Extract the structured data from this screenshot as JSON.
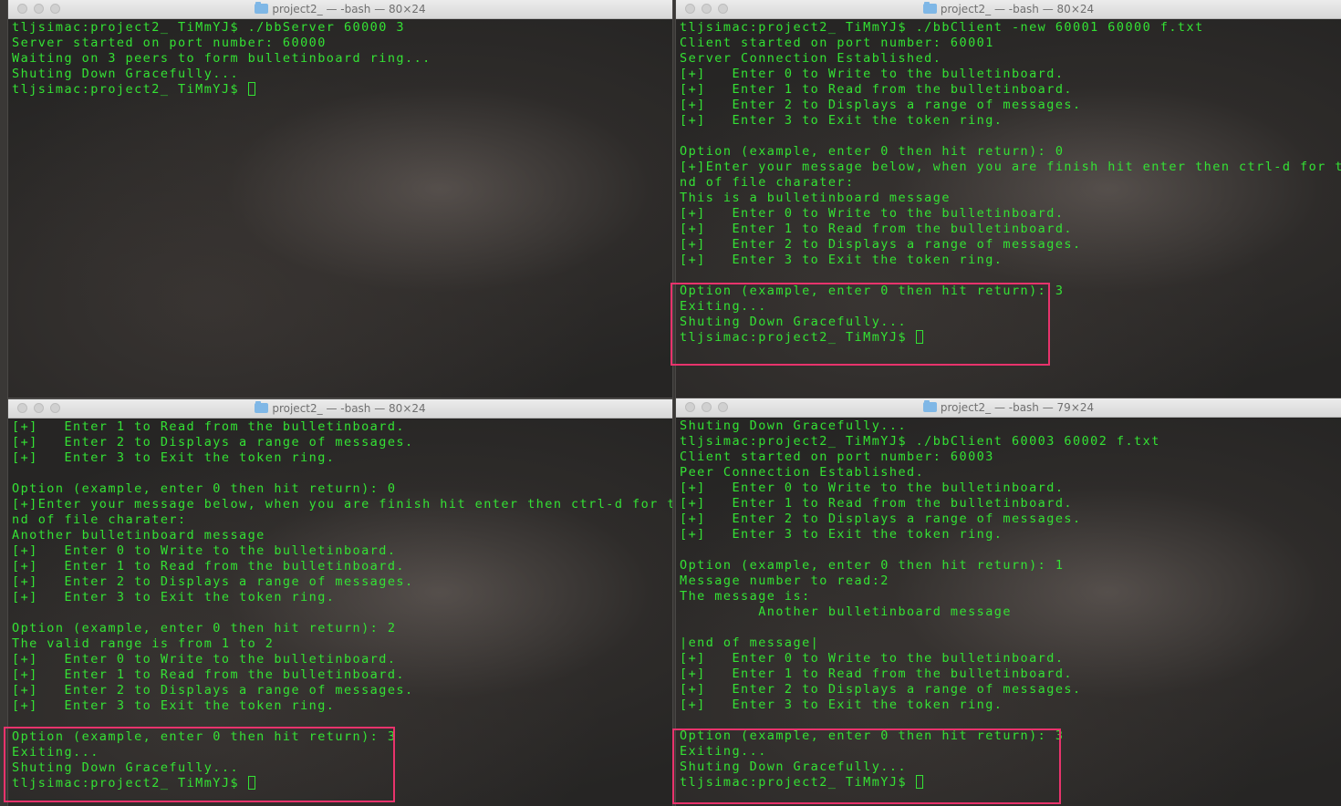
{
  "windows": [
    {
      "title": "project2_ — -bash — 80×24",
      "lines": [
        "tljsimac:project2_ TiMmYJ$ ./bbServer 60000 3",
        "Server started on port number: 60000",
        "Waiting on 3 peers to form bulletinboard ring...",
        "Shuting Down Gracefully...",
        "tljsimac:project2_ TiMmYJ$ "
      ]
    },
    {
      "title": "project2_ — -bash — 80×24",
      "lines": [
        "tljsimac:project2_ TiMmYJ$ ./bbClient -new 60001 60000 f.txt",
        "Client started on port number: 60001",
        "Server Connection Established.",
        "[+]   Enter 0 to Write to the bulletinboard.",
        "[+]   Enter 1 to Read from the bulletinboard.",
        "[+]   Enter 2 to Displays a range of messages.",
        "[+]   Enter 3 to Exit the token ring.",
        "",
        "Option (example, enter 0 then hit return): 0",
        "[+]Enter your message below, when you are finish hit enter then ctrl-d for the e",
        "nd of file charater:",
        "This is a bulletinboard message",
        "[+]   Enter 0 to Write to the bulletinboard.",
        "[+]   Enter 1 to Read from the bulletinboard.",
        "[+]   Enter 2 to Displays a range of messages.",
        "[+]   Enter 3 to Exit the token ring.",
        "",
        "Option (example, enter 0 then hit return): 3",
        "Exiting...",
        "Shuting Down Gracefully...",
        "tljsimac:project2_ TiMmYJ$ "
      ]
    },
    {
      "title": "project2_ — -bash — 80×24",
      "lines": [
        "[+]   Enter 1 to Read from the bulletinboard.",
        "[+]   Enter 2 to Displays a range of messages.",
        "[+]   Enter 3 to Exit the token ring.",
        "",
        "Option (example, enter 0 then hit return): 0",
        "[+]Enter your message below, when you are finish hit enter then ctrl-d for the e",
        "nd of file charater:",
        "Another bulletinboard message",
        "[+]   Enter 0 to Write to the bulletinboard.",
        "[+]   Enter 1 to Read from the bulletinboard.",
        "[+]   Enter 2 to Displays a range of messages.",
        "[+]   Enter 3 to Exit the token ring.",
        "",
        "Option (example, enter 0 then hit return): 2",
        "The valid range is from 1 to 2",
        "[+]   Enter 0 to Write to the bulletinboard.",
        "[+]   Enter 1 to Read from the bulletinboard.",
        "[+]   Enter 2 to Displays a range of messages.",
        "[+]   Enter 3 to Exit the token ring.",
        "",
        "Option (example, enter 0 then hit return): 3",
        "Exiting...",
        "Shuting Down Gracefully...",
        "tljsimac:project2_ TiMmYJ$ "
      ]
    },
    {
      "title": "project2_ — -bash — 79×24",
      "lines": [
        "Shuting Down Gracefully...",
        "tljsimac:project2_ TiMmYJ$ ./bbClient 60003 60002 f.txt",
        "Client started on port number: 60003",
        "Peer Connection Established.",
        "[+]   Enter 0 to Write to the bulletinboard.",
        "[+]   Enter 1 to Read from the bulletinboard.",
        "[+]   Enter 2 to Displays a range of messages.",
        "[+]   Enter 3 to Exit the token ring.",
        "",
        "Option (example, enter 0 then hit return): 1",
        "Message number to read:2",
        "The message is:",
        "         Another bulletinboard message",
        "",
        "|end of message|",
        "[+]   Enter 0 to Write to the bulletinboard.",
        "[+]   Enter 1 to Read from the bulletinboard.",
        "[+]   Enter 2 to Displays a range of messages.",
        "[+]   Enter 3 to Exit the token ring.",
        "",
        "Option (example, enter 0 then hit return): 3",
        "Exiting...",
        "Shuting Down Gracefully...",
        "tljsimac:project2_ TiMmYJ$ "
      ]
    }
  ],
  "colors": {
    "terminal_text": "#34e234",
    "highlight_box": "#e8336c"
  }
}
